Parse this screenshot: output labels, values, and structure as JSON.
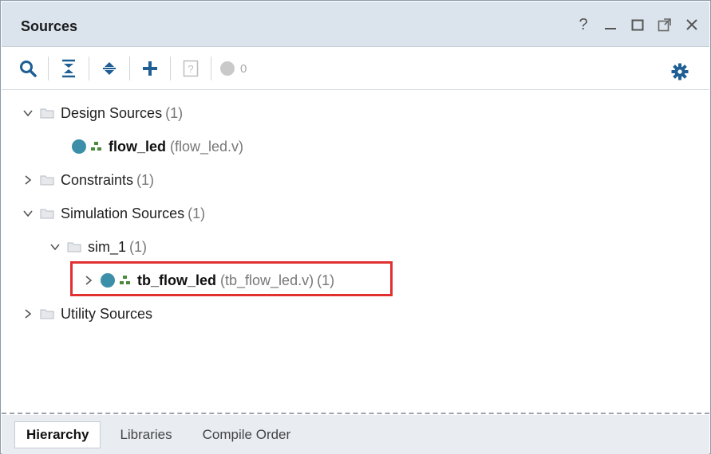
{
  "panel": {
    "title": "Sources",
    "window_controls": [
      "help-icon",
      "minimize-icon",
      "maximize-icon",
      "float-icon",
      "close-icon"
    ],
    "help_label": "?"
  },
  "toolbar": {
    "icons": [
      "search-icon",
      "collapse-all-icon",
      "expand-all-icon",
      "add-icon",
      "unknown-status-icon",
      "status-dot-icon",
      "gear-icon"
    ],
    "status_count": "0"
  },
  "tree": {
    "design_sources": {
      "label": "Design Sources",
      "count": "(1)",
      "expanded": true
    },
    "flow_led": {
      "name": "flow_led",
      "file": "(flow_led.v)"
    },
    "constraints": {
      "label": "Constraints",
      "count": "(1)",
      "expanded": false
    },
    "simulation_sources": {
      "label": "Simulation Sources",
      "count": "(1)",
      "expanded": true
    },
    "sim_1": {
      "label": "sim_1",
      "count": "(1)",
      "expanded": true
    },
    "tb_flow_led": {
      "name": "tb_flow_led",
      "file": "(tb_flow_led.v)",
      "count": "(1)",
      "expanded": false
    },
    "utility_sources": {
      "label": "Utility Sources",
      "expanded": false
    }
  },
  "tabs": [
    {
      "label": "Hierarchy",
      "active": true
    },
    {
      "label": "Libraries",
      "active": false
    },
    {
      "label": "Compile Order",
      "active": false
    }
  ],
  "colors": {
    "title_bar": "#dbe3ec",
    "accent": "#1f5f94",
    "file_dot": "#3b8fa8",
    "highlight": "#e03030"
  }
}
